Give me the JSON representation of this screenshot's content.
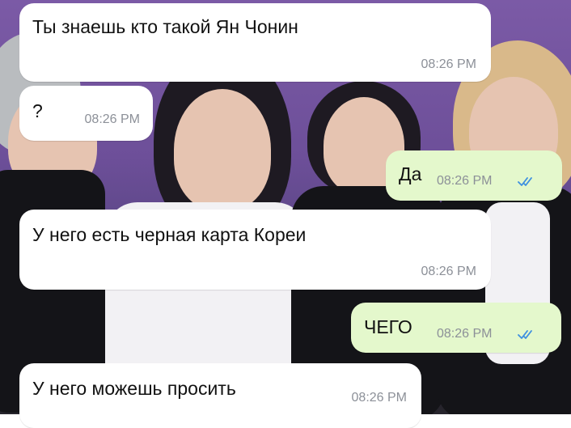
{
  "messages": [
    {
      "direction": "incoming",
      "text": "Ты знаешь кто такой Ян Чонин",
      "time": "08:26 PM"
    },
    {
      "direction": "incoming",
      "text": "?",
      "time": "08:26 PM"
    },
    {
      "direction": "outgoing",
      "text": "Да",
      "time": "08:26 PM",
      "status_icon": "double-check-read-icon"
    },
    {
      "direction": "incoming",
      "text": "У него есть черная карта Кореи",
      "time": "08:26 PM"
    },
    {
      "direction": "outgoing",
      "text": "ЧЕГО",
      "time": "08:26 PM",
      "status_icon": "double-check-read-icon"
    },
    {
      "direction": "incoming",
      "text": "У него можешь просить",
      "time": "08:26 PM"
    }
  ],
  "colors": {
    "incoming_bubble": "#ffffff",
    "outgoing_bubble": "#e4f8cc",
    "timestamp": "#8c9098",
    "read_ticks": "#3d8fe0"
  }
}
